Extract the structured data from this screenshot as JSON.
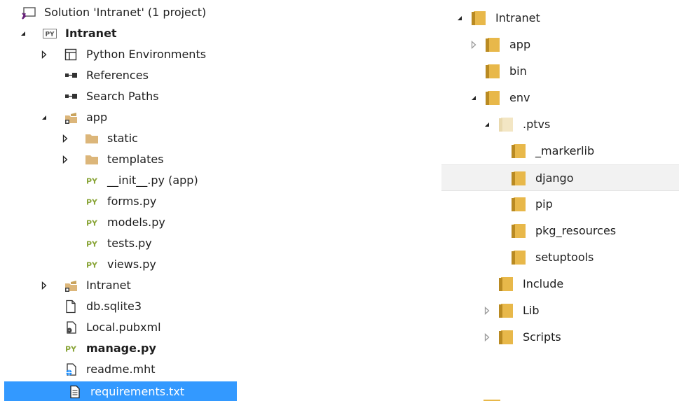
{
  "solution_explorer": {
    "items": [
      {
        "label": "Solution 'Intranet' (1 project)",
        "icon": "solution-icon",
        "expander": "none"
      },
      {
        "label": "Intranet",
        "icon": "python-project-icon",
        "expander": "expanded",
        "bold": true
      },
      {
        "label": "Python Environments",
        "icon": "environments-icon",
        "expander": "collapsed"
      },
      {
        "label": "References",
        "icon": "references-icon",
        "expander": "none"
      },
      {
        "label": "Search Paths",
        "icon": "search-paths-icon",
        "expander": "none"
      },
      {
        "label": "app",
        "icon": "package-folder-icon",
        "expander": "expanded"
      },
      {
        "label": "static",
        "icon": "folder-icon",
        "expander": "collapsed"
      },
      {
        "label": "templates",
        "icon": "folder-icon",
        "expander": "collapsed"
      },
      {
        "label": "__init__.py (app)",
        "icon": "python-file-icon",
        "expander": "none"
      },
      {
        "label": "forms.py",
        "icon": "python-file-icon",
        "expander": "none"
      },
      {
        "label": "models.py",
        "icon": "python-file-icon",
        "expander": "none"
      },
      {
        "label": "tests.py",
        "icon": "python-file-icon",
        "expander": "none"
      },
      {
        "label": "views.py",
        "icon": "python-file-icon",
        "expander": "none"
      },
      {
        "label": "Intranet",
        "icon": "package-folder-icon",
        "expander": "collapsed"
      },
      {
        "label": "db.sqlite3",
        "icon": "file-icon",
        "expander": "none"
      },
      {
        "label": "Local.pubxml",
        "icon": "publish-profile-icon",
        "expander": "none"
      },
      {
        "label": "manage.py",
        "icon": "python-file-icon",
        "expander": "none",
        "bold": true
      },
      {
        "label": "readme.mht",
        "icon": "web-archive-icon",
        "expander": "none"
      },
      {
        "label": "requirements.txt",
        "icon": "text-file-icon",
        "expander": "none",
        "selected": true
      }
    ]
  },
  "folder_tree": {
    "items": [
      {
        "label": "Intranet",
        "expander": "expanded"
      },
      {
        "label": "app",
        "expander": "collapsed"
      },
      {
        "label": "bin",
        "expander": "none"
      },
      {
        "label": "env",
        "expander": "expanded"
      },
      {
        "label": ".ptvs",
        "expander": "expanded",
        "faded": true
      },
      {
        "label": "_markerlib",
        "expander": "none"
      },
      {
        "label": "django",
        "expander": "none",
        "hover": true
      },
      {
        "label": "pip",
        "expander": "none"
      },
      {
        "label": "pkg_resources",
        "expander": "none"
      },
      {
        "label": "setuptools",
        "expander": "none"
      },
      {
        "label": "Include",
        "expander": "none"
      },
      {
        "label": "Lib",
        "expander": "collapsed"
      },
      {
        "label": "Scripts",
        "expander": "collapsed"
      }
    ]
  },
  "colors": {
    "selection": "#3399ff",
    "folder_yellow": "#e8b84a",
    "python_green": "#8aa539",
    "text": "#1e1e1e"
  }
}
